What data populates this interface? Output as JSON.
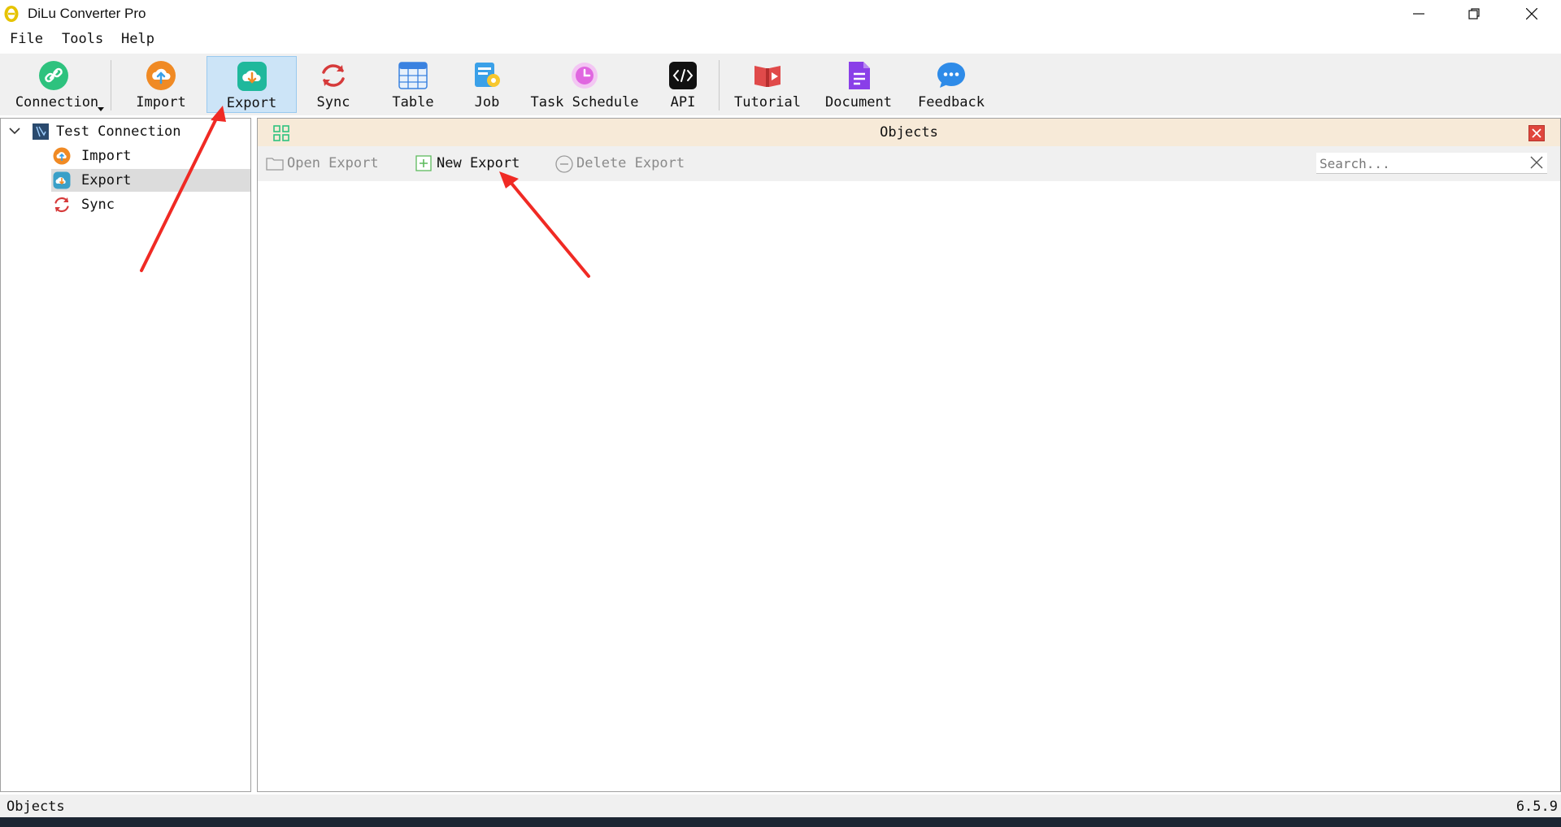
{
  "window": {
    "title": "DiLu Converter Pro"
  },
  "menu": {
    "items": [
      "File",
      "Tools",
      "Help"
    ]
  },
  "toolbar": {
    "buttons": [
      {
        "label": "Connection",
        "icon": "link-icon"
      },
      {
        "label": "Import",
        "icon": "cloud-upload-icon"
      },
      {
        "label": "Export",
        "icon": "cloud-download-icon"
      },
      {
        "label": "Sync",
        "icon": "sync-icon"
      },
      {
        "label": "Table",
        "icon": "table-icon"
      },
      {
        "label": "Job",
        "icon": "job-icon"
      },
      {
        "label": "Task Schedule",
        "icon": "clock-icon"
      },
      {
        "label": "API",
        "icon": "code-icon"
      },
      {
        "label": "Tutorial",
        "icon": "video-book-icon"
      },
      {
        "label": "Document",
        "icon": "document-icon"
      },
      {
        "label": "Feedback",
        "icon": "chat-bubble-icon"
      }
    ],
    "active": "Export"
  },
  "tree": {
    "root": {
      "label": "Test Connection",
      "expanded": true
    },
    "children": [
      {
        "label": "Import",
        "icon": "import-icon"
      },
      {
        "label": "Export",
        "icon": "export-icon",
        "selected": true
      },
      {
        "label": "Sync",
        "icon": "sync-icon"
      }
    ]
  },
  "objects": {
    "title": "Objects",
    "open_label": "Open Export",
    "new_label": "New Export",
    "delete_label": "Delete Export",
    "search_placeholder": "Search..."
  },
  "status": {
    "left": "Objects",
    "version": "6.5.9"
  },
  "colors": {
    "accent": "#cce4f7",
    "header_bg": "#f7ead8",
    "close_red": "#e0463c",
    "annotation_red": "#f02a24"
  }
}
